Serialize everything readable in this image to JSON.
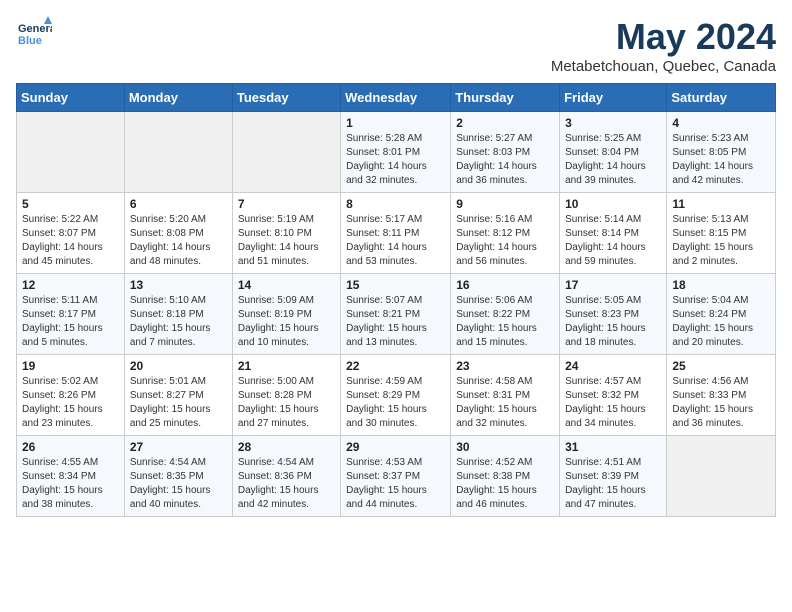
{
  "logo": {
    "text1": "General",
    "text2": "Blue"
  },
  "title": "May 2024",
  "subtitle": "Metabetchouan, Quebec, Canada",
  "weekdays": [
    "Sunday",
    "Monday",
    "Tuesday",
    "Wednesday",
    "Thursday",
    "Friday",
    "Saturday"
  ],
  "weeks": [
    [
      {
        "day": "",
        "content": ""
      },
      {
        "day": "",
        "content": ""
      },
      {
        "day": "",
        "content": ""
      },
      {
        "day": "1",
        "content": "Sunrise: 5:28 AM\nSunset: 8:01 PM\nDaylight: 14 hours\nand 32 minutes."
      },
      {
        "day": "2",
        "content": "Sunrise: 5:27 AM\nSunset: 8:03 PM\nDaylight: 14 hours\nand 36 minutes."
      },
      {
        "day": "3",
        "content": "Sunrise: 5:25 AM\nSunset: 8:04 PM\nDaylight: 14 hours\nand 39 minutes."
      },
      {
        "day": "4",
        "content": "Sunrise: 5:23 AM\nSunset: 8:05 PM\nDaylight: 14 hours\nand 42 minutes."
      }
    ],
    [
      {
        "day": "5",
        "content": "Sunrise: 5:22 AM\nSunset: 8:07 PM\nDaylight: 14 hours\nand 45 minutes."
      },
      {
        "day": "6",
        "content": "Sunrise: 5:20 AM\nSunset: 8:08 PM\nDaylight: 14 hours\nand 48 minutes."
      },
      {
        "day": "7",
        "content": "Sunrise: 5:19 AM\nSunset: 8:10 PM\nDaylight: 14 hours\nand 51 minutes."
      },
      {
        "day": "8",
        "content": "Sunrise: 5:17 AM\nSunset: 8:11 PM\nDaylight: 14 hours\nand 53 minutes."
      },
      {
        "day": "9",
        "content": "Sunrise: 5:16 AM\nSunset: 8:12 PM\nDaylight: 14 hours\nand 56 minutes."
      },
      {
        "day": "10",
        "content": "Sunrise: 5:14 AM\nSunset: 8:14 PM\nDaylight: 14 hours\nand 59 minutes."
      },
      {
        "day": "11",
        "content": "Sunrise: 5:13 AM\nSunset: 8:15 PM\nDaylight: 15 hours\nand 2 minutes."
      }
    ],
    [
      {
        "day": "12",
        "content": "Sunrise: 5:11 AM\nSunset: 8:17 PM\nDaylight: 15 hours\nand 5 minutes."
      },
      {
        "day": "13",
        "content": "Sunrise: 5:10 AM\nSunset: 8:18 PM\nDaylight: 15 hours\nand 7 minutes."
      },
      {
        "day": "14",
        "content": "Sunrise: 5:09 AM\nSunset: 8:19 PM\nDaylight: 15 hours\nand 10 minutes."
      },
      {
        "day": "15",
        "content": "Sunrise: 5:07 AM\nSunset: 8:21 PM\nDaylight: 15 hours\nand 13 minutes."
      },
      {
        "day": "16",
        "content": "Sunrise: 5:06 AM\nSunset: 8:22 PM\nDaylight: 15 hours\nand 15 minutes."
      },
      {
        "day": "17",
        "content": "Sunrise: 5:05 AM\nSunset: 8:23 PM\nDaylight: 15 hours\nand 18 minutes."
      },
      {
        "day": "18",
        "content": "Sunrise: 5:04 AM\nSunset: 8:24 PM\nDaylight: 15 hours\nand 20 minutes."
      }
    ],
    [
      {
        "day": "19",
        "content": "Sunrise: 5:02 AM\nSunset: 8:26 PM\nDaylight: 15 hours\nand 23 minutes."
      },
      {
        "day": "20",
        "content": "Sunrise: 5:01 AM\nSunset: 8:27 PM\nDaylight: 15 hours\nand 25 minutes."
      },
      {
        "day": "21",
        "content": "Sunrise: 5:00 AM\nSunset: 8:28 PM\nDaylight: 15 hours\nand 27 minutes."
      },
      {
        "day": "22",
        "content": "Sunrise: 4:59 AM\nSunset: 8:29 PM\nDaylight: 15 hours\nand 30 minutes."
      },
      {
        "day": "23",
        "content": "Sunrise: 4:58 AM\nSunset: 8:31 PM\nDaylight: 15 hours\nand 32 minutes."
      },
      {
        "day": "24",
        "content": "Sunrise: 4:57 AM\nSunset: 8:32 PM\nDaylight: 15 hours\nand 34 minutes."
      },
      {
        "day": "25",
        "content": "Sunrise: 4:56 AM\nSunset: 8:33 PM\nDaylight: 15 hours\nand 36 minutes."
      }
    ],
    [
      {
        "day": "26",
        "content": "Sunrise: 4:55 AM\nSunset: 8:34 PM\nDaylight: 15 hours\nand 38 minutes."
      },
      {
        "day": "27",
        "content": "Sunrise: 4:54 AM\nSunset: 8:35 PM\nDaylight: 15 hours\nand 40 minutes."
      },
      {
        "day": "28",
        "content": "Sunrise: 4:54 AM\nSunset: 8:36 PM\nDaylight: 15 hours\nand 42 minutes."
      },
      {
        "day": "29",
        "content": "Sunrise: 4:53 AM\nSunset: 8:37 PM\nDaylight: 15 hours\nand 44 minutes."
      },
      {
        "day": "30",
        "content": "Sunrise: 4:52 AM\nSunset: 8:38 PM\nDaylight: 15 hours\nand 46 minutes."
      },
      {
        "day": "31",
        "content": "Sunrise: 4:51 AM\nSunset: 8:39 PM\nDaylight: 15 hours\nand 47 minutes."
      },
      {
        "day": "",
        "content": ""
      }
    ]
  ]
}
